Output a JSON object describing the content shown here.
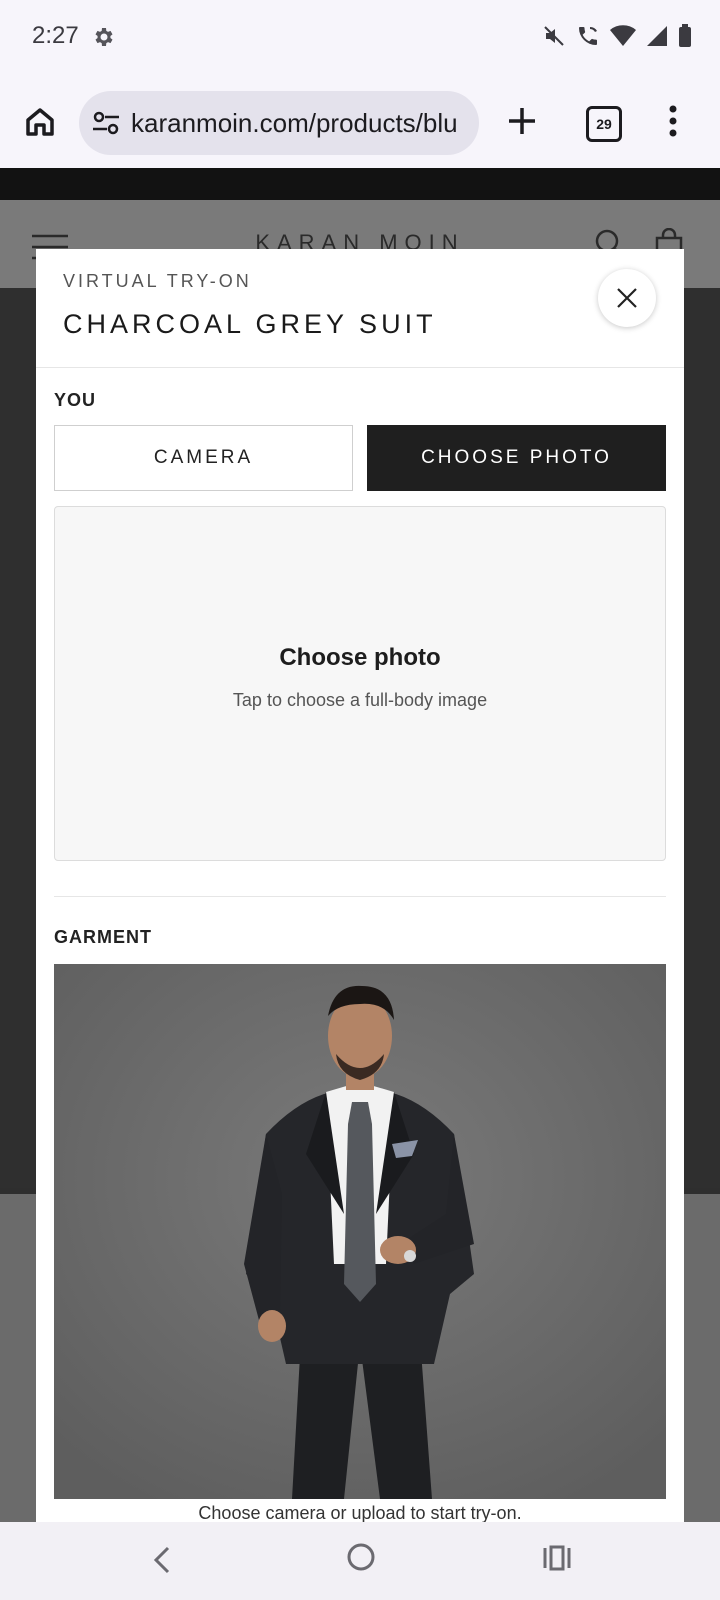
{
  "status_bar": {
    "time": "2:27",
    "icons": [
      "settings-icon",
      "mute-icon",
      "wifi-call-icon",
      "wifi-icon",
      "signal-icon",
      "battery-icon"
    ]
  },
  "browser": {
    "url": "karanmoin.com/products/blu",
    "tab_count": "29"
  },
  "site": {
    "logo": "KARAN MOIN"
  },
  "modal": {
    "eyebrow": "VIRTUAL TRY-ON",
    "title": "CHARCOAL GREY SUIT",
    "you_label": "YOU",
    "camera_label": "CAMERA",
    "choose_photo_label": "CHOOSE PHOTO",
    "dropzone_title": "Choose photo",
    "dropzone_subtitle": "Tap to choose a full-body image",
    "garment_label": "GARMENT",
    "hint": "Choose camera or upload to start try-on."
  },
  "colors": {
    "active_segment": "#1f1f1f",
    "modal_bg": "#ffffff",
    "overlay_bg": "#2e2e2e"
  }
}
